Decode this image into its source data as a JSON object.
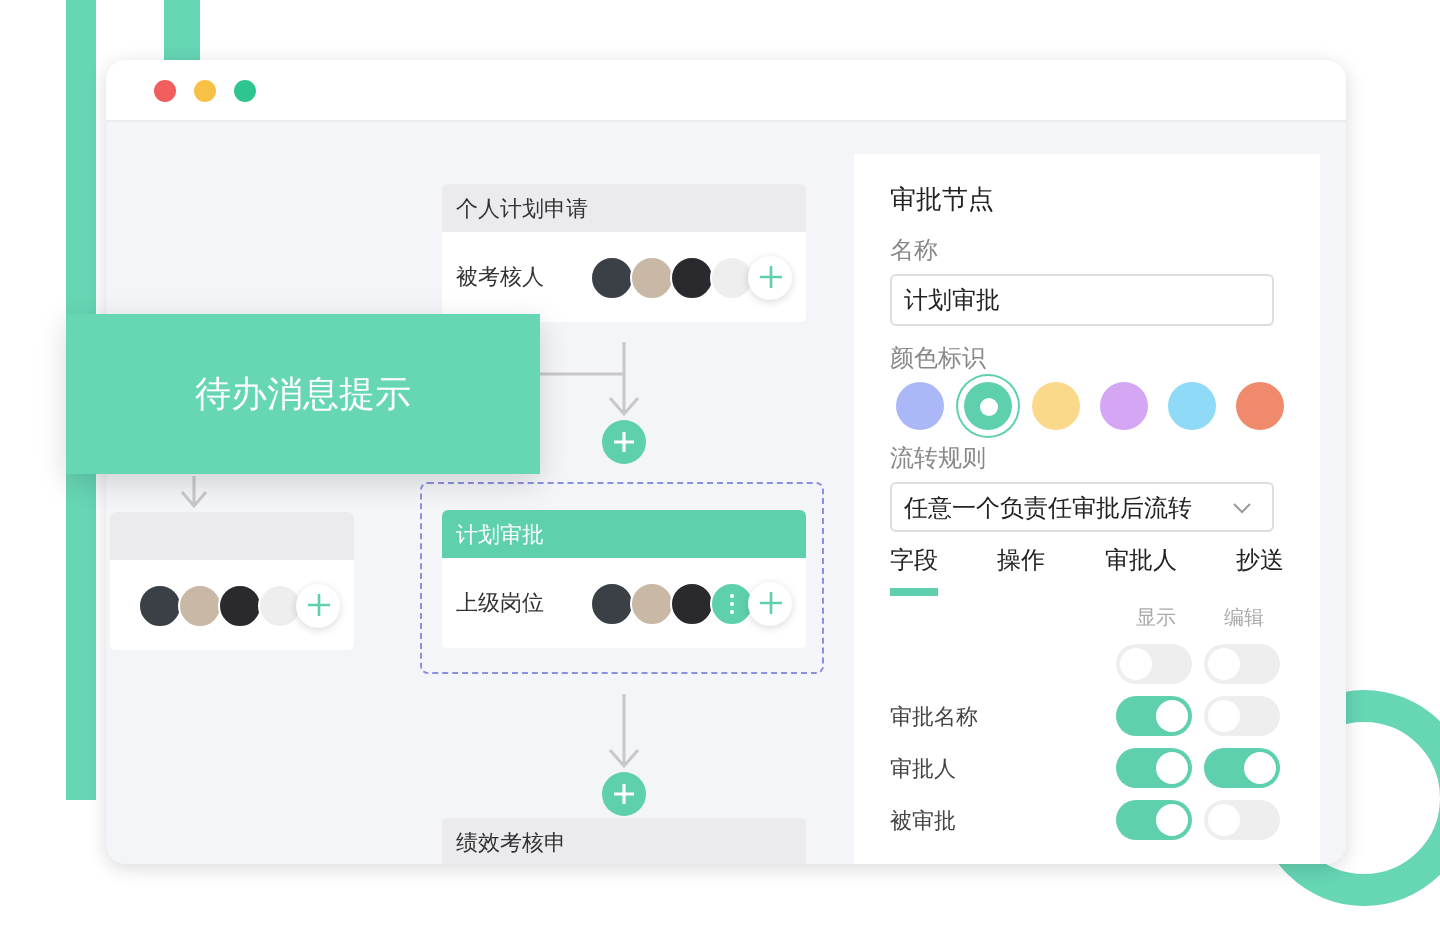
{
  "popup": {
    "text": "待办消息提示"
  },
  "nodes": [
    {
      "selected": false,
      "members": [
        {
          "kind": "avatar"
        },
        {
          "kind": "avatar"
        },
        {
          "kind": "avatar"
        },
        {
          "kind": "blank"
        }
      ]
    },
    {
      "title": "个人计划申请",
      "selected": false,
      "label": "被考核人",
      "members": [
        {
          "kind": "avatar"
        },
        {
          "kind": "avatar"
        },
        {
          "kind": "avatar"
        },
        {
          "kind": "blank"
        }
      ]
    },
    {
      "title": "计划审批",
      "selected": true,
      "label": "上级岗位",
      "members": [
        {
          "kind": "avatar"
        },
        {
          "kind": "avatar"
        },
        {
          "kind": "avatar"
        },
        {
          "kind": "more"
        }
      ]
    },
    {
      "title": "绩效考核申",
      "selected": false
    }
  ],
  "panel": {
    "title": "审批节点",
    "name_label": "名称",
    "name_value": "计划审批",
    "color_label": "颜色标识",
    "colors": [
      {
        "color": "#aab8f7",
        "selected": false
      },
      {
        "color": "#5fd0ae",
        "selected": true
      },
      {
        "color": "#fbd98a",
        "selected": false
      },
      {
        "color": "#d4a7f5",
        "selected": false
      },
      {
        "color": "#8fdaf7",
        "selected": false
      },
      {
        "color": "#f08a6c",
        "selected": false
      }
    ],
    "rule_label": "流转规则",
    "rule_value": "任意一个负责任审批后流转",
    "tabs": [
      {
        "label": "字段",
        "selected": true
      },
      {
        "label": "操作",
        "selected": false
      },
      {
        "label": "审批人",
        "selected": false
      },
      {
        "label": "抄送",
        "selected": false
      }
    ],
    "columns": [
      "显示",
      "编辑"
    ],
    "rows": [
      {
        "show": false,
        "edit": false
      },
      {
        "label": "审批名称",
        "show": true,
        "edit": false
      },
      {
        "label": "审批人",
        "show": true,
        "edit": true
      },
      {
        "label": "被审批",
        "show": true,
        "edit": false
      }
    ]
  }
}
